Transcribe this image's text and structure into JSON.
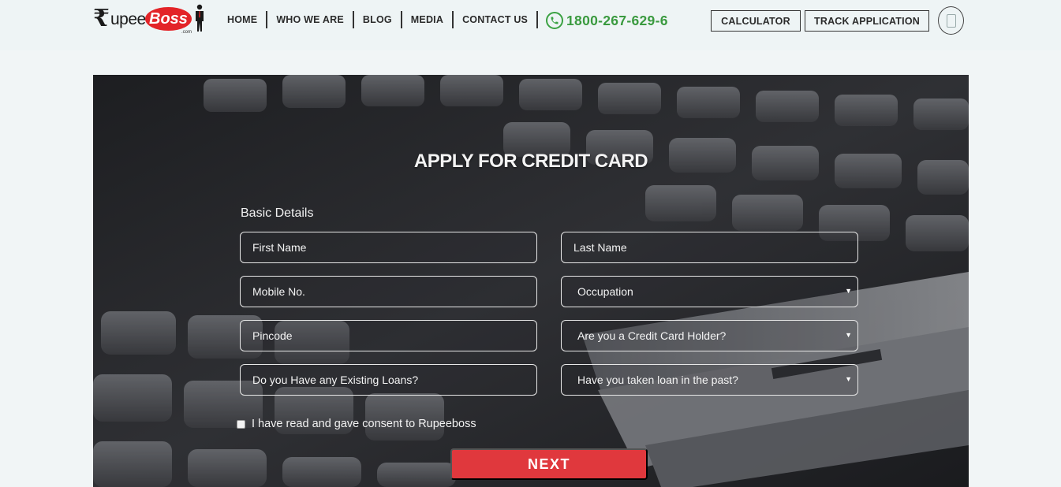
{
  "brand": {
    "rupee_symbol": "₹",
    "name_part1": "upee",
    "name_part2": "Boss",
    "domain_suffix": ".com",
    "accent": "#e32428"
  },
  "nav": {
    "items": [
      {
        "label": "HOME"
      },
      {
        "label": "WHO WE ARE"
      },
      {
        "label": "BLOG"
      },
      {
        "label": "MEDIA"
      },
      {
        "label": "CONTACT US"
      }
    ]
  },
  "phone": {
    "icon": "phone-icon",
    "number": "1800-267-629-6",
    "color": "#3a9a3f"
  },
  "header_buttons": {
    "calculator": "CALCULATOR",
    "track": "TRACK APPLICATION",
    "mobile_icon": "mobile-icon"
  },
  "form": {
    "title": "APPLY FOR CREDIT CARD",
    "section": "Basic Details",
    "fields": {
      "first_name": "First Name",
      "last_name": "Last Name",
      "mobile": "Mobile No.",
      "occupation": "Occupation",
      "pincode": "Pincode",
      "card_holder": "Are you a Credit Card Holder?",
      "existing_loans": "Do you Have any Existing Loans?",
      "past_loan": "Have you taken loan in the past?"
    },
    "consent": "I have read and gave consent to Rupeeboss",
    "submit": "NEXT",
    "submit_color": "#e0383d"
  }
}
